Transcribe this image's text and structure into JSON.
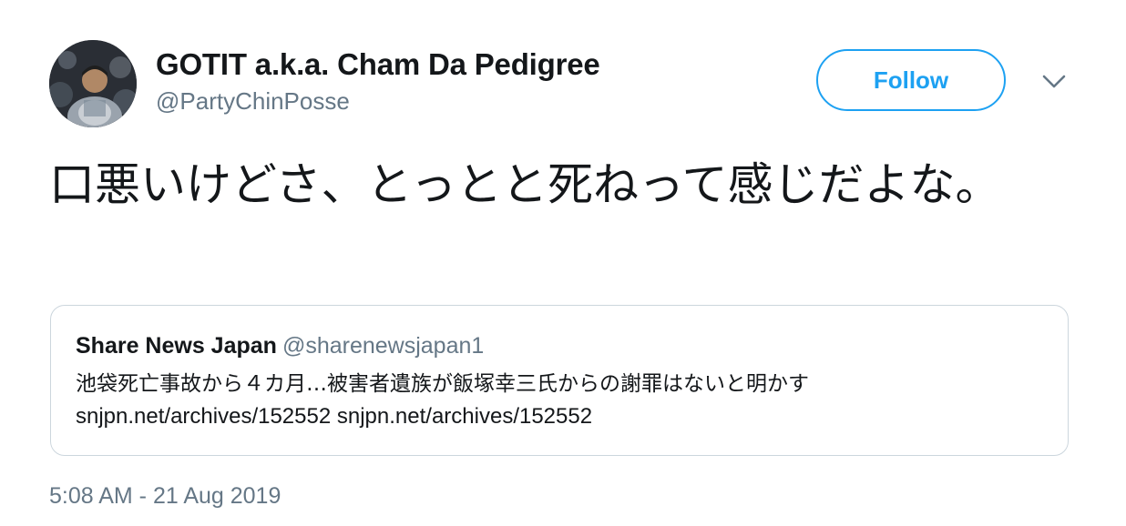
{
  "user": {
    "display_name": "GOTIT a.k.a. Cham Da Pedigree",
    "handle": "@PartyChinPosse"
  },
  "actions": {
    "follow_label": "Follow",
    "menu_icon": "chevron-down-icon"
  },
  "tweet": {
    "text": "口悪いけどさ、とっとと死ねって感じだよな。",
    "timestamp": "5:08 AM - 21 Aug 2019"
  },
  "quoted_tweet": {
    "author_name": "Share News Japan",
    "author_handle": "@sharenewsjapan1",
    "text": "池袋死亡事故から４カ月…被害者遺族が飯塚幸三氏からの謝罪はないと明かす",
    "link_1": "snjpn.net/archives/152552",
    "link_2": "snjpn.net/archives/152552"
  },
  "colors": {
    "accent": "#1da1f2",
    "text_primary": "#14171a",
    "text_secondary": "#657786",
    "card_border": "#ccd6dd"
  }
}
